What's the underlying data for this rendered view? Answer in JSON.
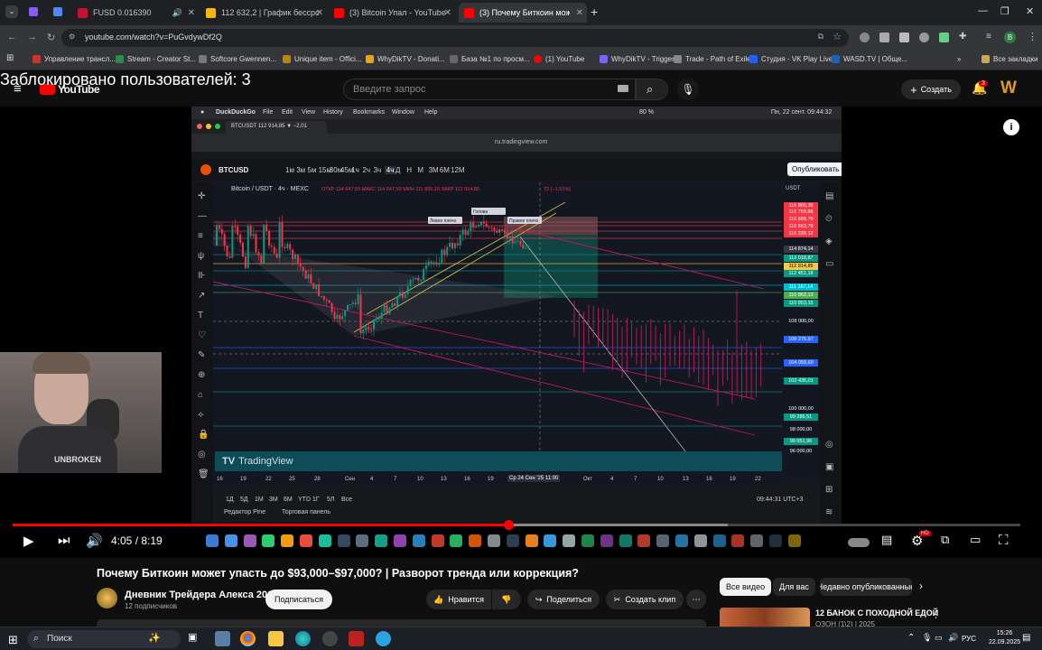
{
  "browser": {
    "tabs": [
      {
        "label": "FUSD 0.016390",
        "color": "#c41230"
      },
      {
        "label": "112 632,2 | График бессрочны",
        "color": "#f0b90b"
      },
      {
        "label": "(3) Bitcoin Упал - YouTube",
        "color": "#ff0000"
      },
      {
        "label": "(3) Почему Биткоин может уп",
        "color": "#ff0000"
      }
    ],
    "url": "youtube.com/watch?v=PuGvdywDf2Q",
    "bookmarks": [
      "Управление трансл...",
      "Stream - Creator St...",
      "Softcore Gwennen...",
      "Unique item - Offici...",
      "WhyDikTV - Donati...",
      "База №1 по просм...",
      "(1) YouTube",
      "WhyDikTV - Triggerf...",
      "Trade - Path of Exile",
      "Студия - VK Play Live",
      "WASD.TV | Обще...",
      "Все закладки"
    ]
  },
  "overlay": {
    "blocked_text": "Заблокировано пользователей: 3"
  },
  "youtube": {
    "logo": "YouTube",
    "search_placeholder": "Введите запрос",
    "create_label": "Создать",
    "notif_count": "3",
    "avatar_letter": "W"
  },
  "tv": {
    "mac_app": "DuckDuckGo",
    "mac_menus": [
      "File",
      "Edit",
      "View",
      "History",
      "Bookmarks",
      "Window",
      "Help"
    ],
    "mac_battery": "80 %",
    "mac_time": "Пн, 22 сент.  09:44:32",
    "tab_title": "BTCUSDT 112 914,85 ▼ −2,01",
    "address": "ru.tradingview.com",
    "symbol": "BTCUSD",
    "intervals": [
      "1м",
      "3м",
      "5м",
      "15м",
      "30м",
      "45м",
      "1ч",
      "2ч",
      "3ч",
      "4ч",
      "Д",
      "Н",
      "М",
      "3М",
      "6М",
      "12М"
    ],
    "publish_label": "Опубликовать",
    "legend": "Bitcoin / USDT · 4ч · MEXC",
    "ohlc": "ОТКР 114 647,59   МАКС 114 647,59   МИН 111 865,19   ЗАКР 112 914,85",
    "change": "72 (−1,51%)",
    "currency": "USDT",
    "price_levels": [
      {
        "text": "116 865,36",
        "color": "#f23645"
      },
      {
        "text": "116 759,86",
        "color": "#f23645"
      },
      {
        "text": "116 689,79",
        "color": "#f23645"
      },
      {
        "text": "116 563,79",
        "color": "#f23645"
      },
      {
        "text": "116 339,12",
        "color": "#f23645"
      },
      {
        "text": "114 874,14",
        "color": "#363a45"
      },
      {
        "text": "113 018,87",
        "color": "#089981"
      },
      {
        "text": "112 914,85",
        "color": "#f7c843"
      },
      {
        "text": "112 451,18",
        "color": "#089981"
      },
      {
        "text": "111 167,14",
        "color": "#00bcd4"
      },
      {
        "text": "110 862,13",
        "color": "#4caf50"
      },
      {
        "text": "110 853,15",
        "color": "#089981"
      },
      {
        "text": "108 000,00",
        "color": ""
      },
      {
        "text": "106 276,97",
        "color": "#2962ff"
      },
      {
        "text": "104 059,69",
        "color": "#2962ff"
      },
      {
        "text": "102 435,01",
        "color": "#089981"
      },
      {
        "text": "100 000,00",
        "color": ""
      },
      {
        "text": "99 286,51",
        "color": "#089981"
      },
      {
        "text": "98 000,00",
        "color": ""
      },
      {
        "text": "96 051,96",
        "color": "#089981"
      },
      {
        "text": "96 000,00",
        "color": ""
      }
    ],
    "xaxis": [
      "16",
      "19",
      "22",
      "25",
      "28",
      "Сен",
      "4",
      "7",
      "10",
      "13",
      "16",
      "19",
      "Ср 24 Сен '25   11:00",
      "Окт",
      "4",
      "7",
      "10",
      "13",
      "16",
      "19",
      "22"
    ],
    "range_buttons": [
      "1Д",
      "5Д",
      "1М",
      "3М",
      "6М",
      "YTD",
      "1Г",
      "5Л",
      "Все"
    ],
    "clock": "09:44:31 UTC+3",
    "bottom_tabs": [
      "Редактор Pine",
      "Торговая панель"
    ],
    "watermark": "TradingView",
    "annotations": [
      "Левое плечо",
      "Голова",
      "Правое плечо"
    ]
  },
  "player": {
    "current_time": "4:05",
    "duration": "8:19",
    "progress": 0.492,
    "buffered": 0.71
  },
  "video": {
    "title": "Почему Биткоин может упасть до $93,000–$97,000? | Разворот тренда или коррекция?",
    "channel": "Дневник Трейдера Алекса 2017",
    "subscribers": "12 подписчиков",
    "subscribe_label": "Подписаться",
    "like_label": "Нравится",
    "share_label": "Поделиться",
    "clip_label": "Создать клип"
  },
  "sidebar": {
    "chips": [
      "Все видео",
      "Для вас",
      "Недавно опубликованные"
    ],
    "rec_title": "12 БАНОК С ПОХОДНОЙ ЕДОЙ",
    "rec_subtitle": "ОЗОН (1\\2) | 2025"
  },
  "taskbar": {
    "search": "Поиск",
    "lang": "РУС",
    "time": "15:26",
    "date": "22.09.2025"
  },
  "webcam": {
    "shirt_text": "UNBROKEN"
  }
}
